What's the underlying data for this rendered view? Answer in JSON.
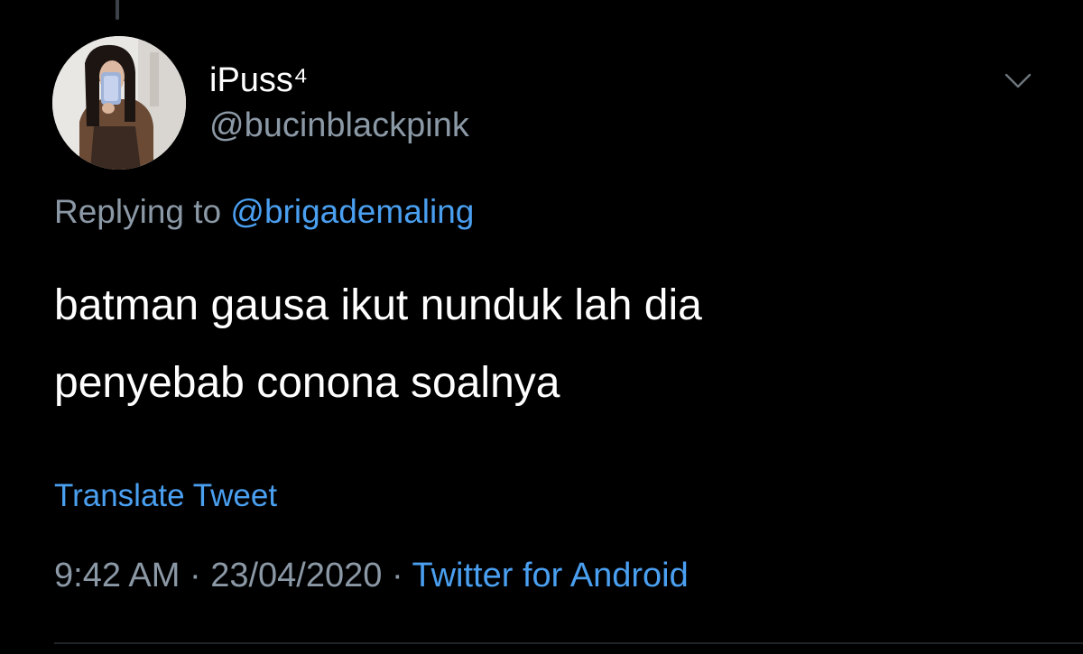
{
  "tweet": {
    "display_name": "iPuss⁴",
    "handle": "@bucinblackpink",
    "reply_label": "Replying to",
    "reply_to": "@brigademaling",
    "text_lines": [
      "batman gausa ikut nunduk lah dia",
      "penyebab conona soalnya"
    ],
    "translate_label": "Translate Tweet",
    "time": "9:42 AM",
    "separator": "·",
    "date": "23/04/2020",
    "source": "Twitter for Android"
  },
  "icons": {
    "more": "chevron-down-icon",
    "avatar": "profile-photo"
  },
  "colors": {
    "background": "#000000",
    "primary_text": "#ffffff",
    "secondary_text": "#8b98a5",
    "link": "#4a9ff0"
  }
}
